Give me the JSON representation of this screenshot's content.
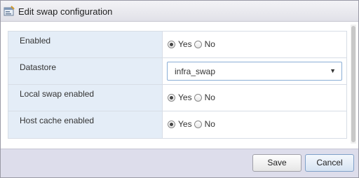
{
  "dialog": {
    "title": "Edit swap configuration",
    "title_icon": "host-settings-icon"
  },
  "form": {
    "rows": [
      {
        "label": "Enabled",
        "type": "radio",
        "options": [
          "Yes",
          "No"
        ],
        "selected": "Yes"
      },
      {
        "label": "Datastore",
        "type": "select",
        "value": "infra_swap"
      },
      {
        "label": "Local swap enabled",
        "type": "radio",
        "options": [
          "Yes",
          "No"
        ],
        "selected": "Yes"
      },
      {
        "label": "Host cache enabled",
        "type": "radio",
        "options": [
          "Yes",
          "No"
        ],
        "selected": "Yes"
      }
    ]
  },
  "footer": {
    "save_label": "Save",
    "cancel_label": "Cancel"
  },
  "colors": {
    "label_cell_bg": "#e4edf7",
    "footer_bg": "#ddddeb",
    "select_border": "#8aaed6"
  }
}
